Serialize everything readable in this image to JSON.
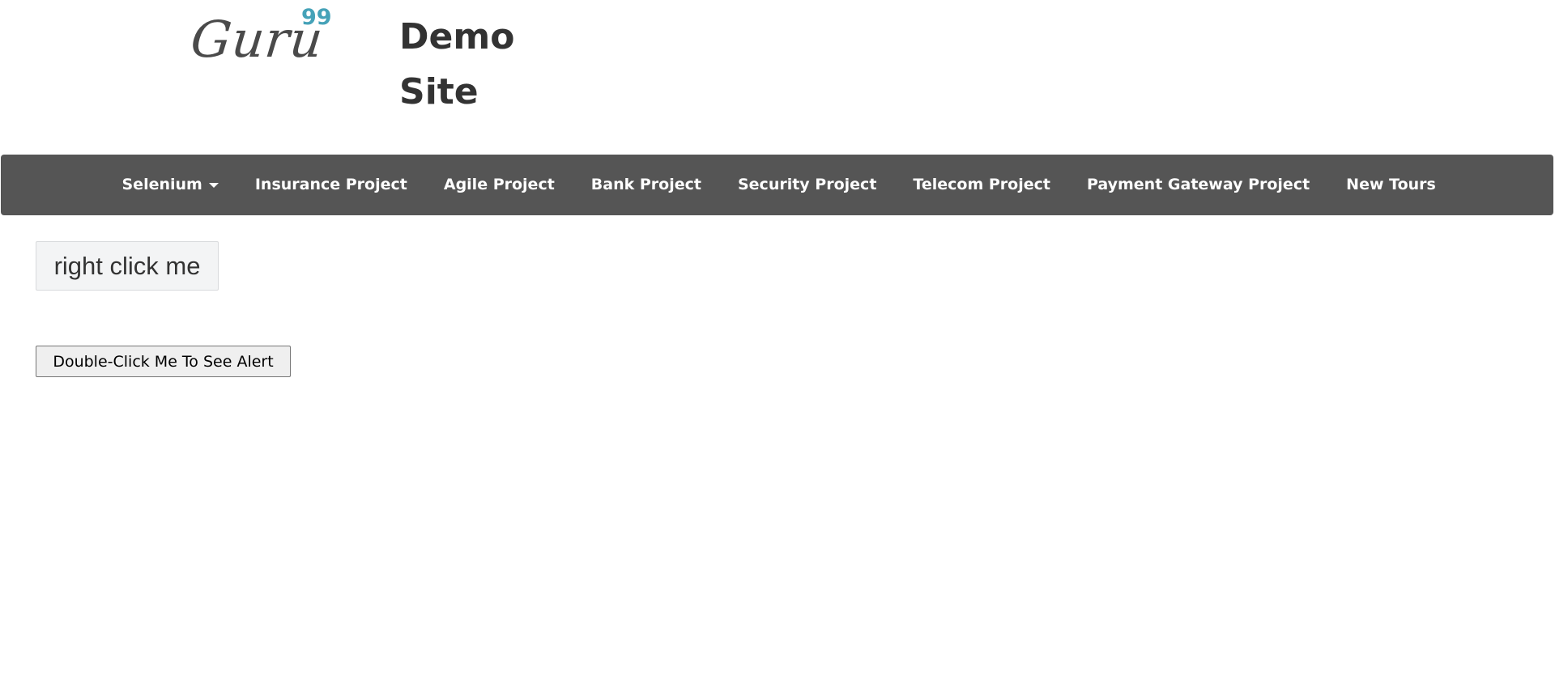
{
  "header": {
    "logo_text": "Guru",
    "logo_superscript": "99",
    "site_title_line1": "Demo",
    "site_title_line2": "Site"
  },
  "navbar": {
    "items": [
      {
        "label": "Selenium",
        "has_dropdown": true
      },
      {
        "label": "Insurance Project"
      },
      {
        "label": "Agile Project"
      },
      {
        "label": "Bank Project"
      },
      {
        "label": "Security Project"
      },
      {
        "label": "Telecom Project"
      },
      {
        "label": "Payment Gateway Project"
      },
      {
        "label": "New Tours"
      }
    ],
    "background_color": "#555555",
    "text_color": "#ffffff"
  },
  "main": {
    "right_click_label": "right click me",
    "double_click_label": "Double-Click Me To See Alert"
  },
  "colors": {
    "logo_accent": "#45a2b8",
    "logo_text": "#4a4a4a"
  }
}
